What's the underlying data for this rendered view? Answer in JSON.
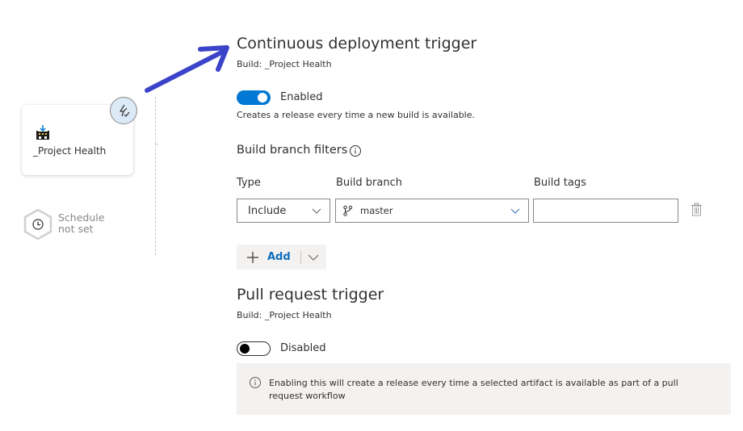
{
  "pipeline": {
    "artifact": {
      "name": "_Project Health",
      "icon": "build-artifact-icon",
      "trigger_icon": "lightning-trigger-icon"
    },
    "schedule": {
      "line1": "Schedule",
      "line2": "not set",
      "icon": "clock-icon"
    }
  },
  "annotation": {
    "arrow_color": "#3b44c9"
  },
  "continuous_deployment": {
    "title": "Continuous deployment trigger",
    "build_label": "Build: _Project Health",
    "toggle_state": "on",
    "toggle_label": "Enabled",
    "description": "Creates a release every time a new build is available."
  },
  "branch_filters": {
    "title": "Build branch filters",
    "info_icon": "info-icon",
    "columns": {
      "type": "Type",
      "branch": "Build branch",
      "tags": "Build tags"
    },
    "rows": [
      {
        "type": "Include",
        "branch": "master",
        "tags": ""
      }
    ],
    "add_label": "Add"
  },
  "pull_request": {
    "title": "Pull request trigger",
    "build_label": "Build: _Project Health",
    "toggle_state": "off",
    "toggle_label": "Disabled",
    "info_message": "Enabling this will create a release every time a selected artifact is available as part of a pull request workflow"
  },
  "colors": {
    "accent": "#0078d4",
    "link": "#106ebe",
    "info_bg": "#f3f2f1"
  }
}
